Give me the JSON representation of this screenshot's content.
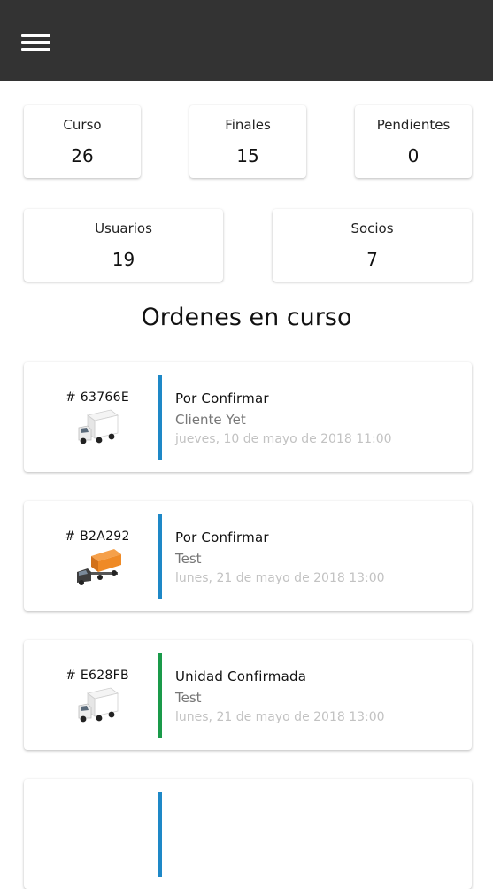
{
  "header": {
    "menu_icon": "hamburger-menu-icon",
    "background": "#333333"
  },
  "stats_row1": [
    {
      "label": "Curso",
      "value": "26"
    },
    {
      "label": "Finales",
      "value": "15"
    },
    {
      "label": "Pendientes",
      "value": "0"
    }
  ],
  "stats_row2": [
    {
      "label": "Usuarios",
      "value": "19"
    },
    {
      "label": "Socios",
      "value": "7"
    }
  ],
  "section_title": "Ordenes en curso",
  "orders": [
    {
      "id": "# 63766E",
      "status": "Por Confirmar",
      "client": "Cliente Yet",
      "date": "jueves, 10 de mayo de 2018 11:00",
      "accent": "#1e88c7",
      "truck_icon": "white-box-truck-icon"
    },
    {
      "id": "# B2A292",
      "status": "Por Confirmar",
      "client": "Test",
      "date": "lunes, 21 de mayo de 2018 13:00",
      "accent": "#1e88c7",
      "truck_icon": "orange-semi-truck-icon"
    },
    {
      "id": "# E628FB",
      "status": "Unidad Confirmada",
      "client": "Test",
      "date": "lunes, 21 de mayo de 2018 13:00",
      "accent": "#1a9a4a",
      "truck_icon": "white-box-truck-icon"
    }
  ]
}
